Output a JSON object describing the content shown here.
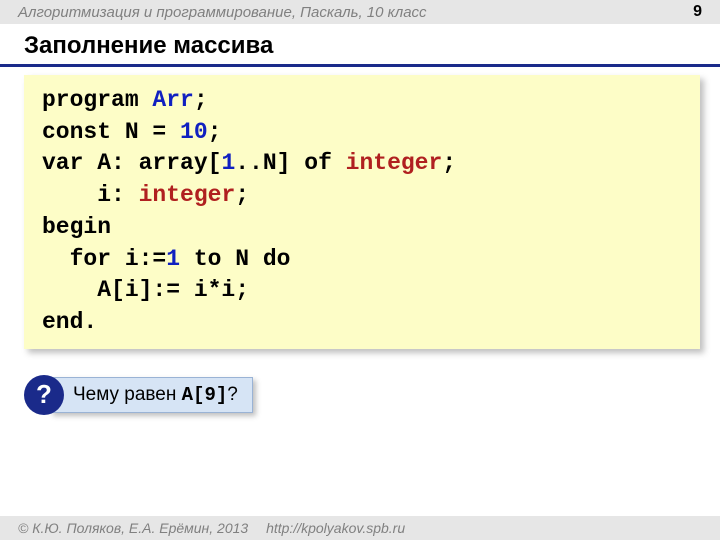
{
  "header": {
    "course": "Алгоритмизация и программирование, Паскаль, 10 класс",
    "page": "9"
  },
  "title": "Заполнение массива",
  "code": {
    "l1": {
      "a": "program ",
      "b": "Arr",
      "c": ";"
    },
    "l2": {
      "a": "const N = ",
      "b": "10",
      "c": ";"
    },
    "l3": {
      "a": "var A: array[",
      "b": "1",
      "c": "..N] of ",
      "d": "integer",
      "e": ";"
    },
    "l4": {
      "a": "    i: ",
      "b": "integer",
      "c": ";"
    },
    "l5": {
      "a": "begin"
    },
    "l6": {
      "a": "  for i:=",
      "b": "1",
      "c": " to N do"
    },
    "l7": {
      "a": "    A[i]:= i*i;"
    },
    "l8": {
      "a": "end."
    }
  },
  "question": {
    "badge": "?",
    "pre": "Чему равен ",
    "mono": "A[9]",
    "post": "?"
  },
  "footer": {
    "copyright": "© К.Ю. Поляков, Е.А. Ерёмин, 2013",
    "url": "http://kpolyakov.spb.ru"
  }
}
